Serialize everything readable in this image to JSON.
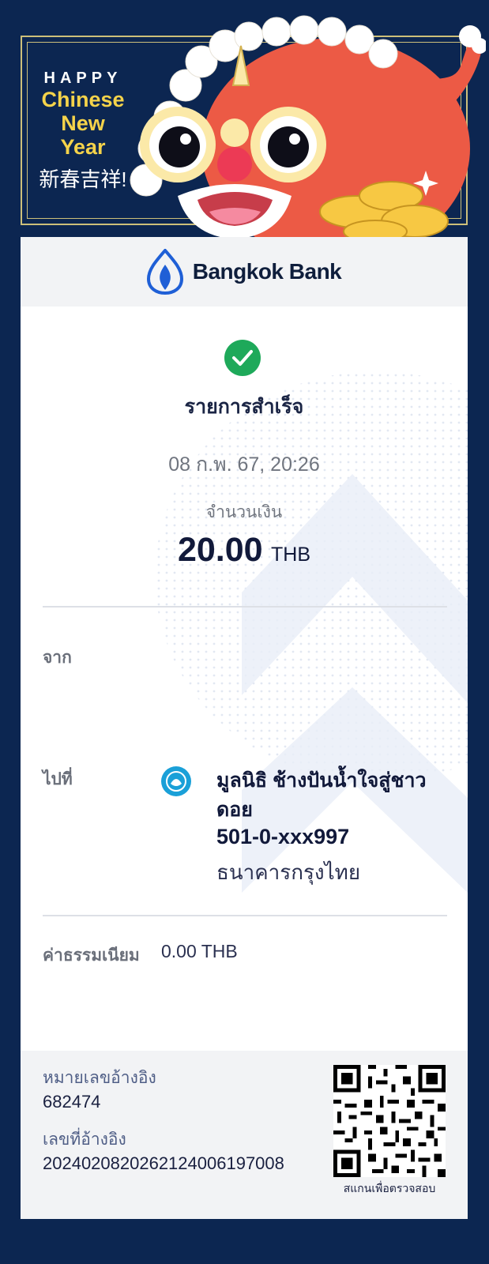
{
  "banner": {
    "happy": "HAPPY",
    "line1": "Chinese",
    "line2": "New",
    "line3": "Year",
    "chinese": "新春吉祥!"
  },
  "header": {
    "bank_name": "Bangkok Bank",
    "logo_icon": "bangkok-bank-lotus-icon"
  },
  "status": {
    "icon": "check-circle-icon",
    "text": "รายการสำเร็จ",
    "color": "#1ea95a"
  },
  "transaction": {
    "datetime": "08 ก.พ. 67, 20:26",
    "amount_label": "จำนวนเงิน",
    "amount": "20.00",
    "currency": "THB"
  },
  "from": {
    "label": "จาก"
  },
  "to": {
    "label": "ไปที่",
    "bank_icon": "krungthai-bank-icon",
    "name": "มูลนิธิ ช้างปันน้ำใจสู่ชาวดอย",
    "account": "501-0-xxx997",
    "bank": "ธนาคารกรุงไทย"
  },
  "fee": {
    "label": "ค่าธรรมเนียม",
    "value": "0.00 THB"
  },
  "footer": {
    "ref1_label": "หมายเลขอ้างอิง",
    "ref1_value": "682474",
    "ref2_label": "เลขที่อ้างอิง",
    "ref2_value": "2024020820262124006197008",
    "qr_icon": "qr-code-icon",
    "qr_caption": "สแกนเพื่อตรวจสอบ"
  },
  "colors": {
    "background": "#0c2651",
    "brand_blue": "#1f5fd6",
    "accent_gold": "#f5d34a"
  }
}
